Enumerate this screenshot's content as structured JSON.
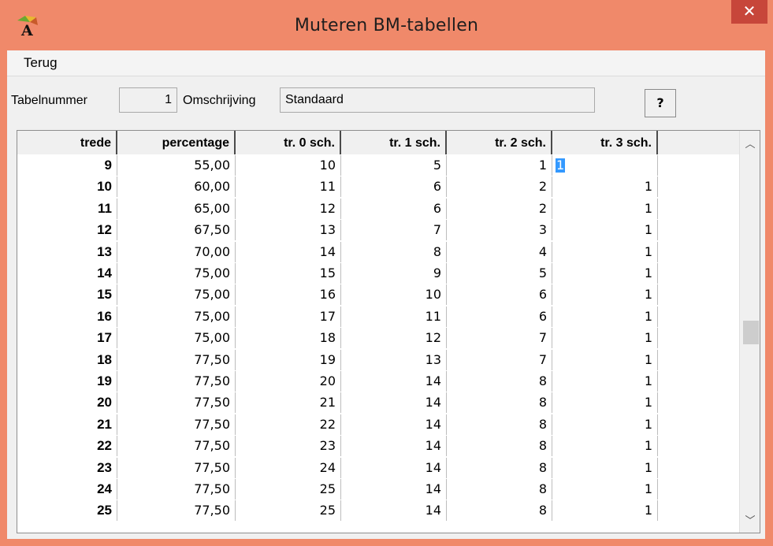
{
  "window": {
    "title": "Muteren BM-tabellen",
    "close_glyph": "✕",
    "icon": "app-A-icon"
  },
  "menu": {
    "items": [
      "Terug"
    ]
  },
  "fields": {
    "tabelnummer_label": "Tabelnummer",
    "tabelnummer_value": "1",
    "omschrijving_label": "Omschrijving",
    "omschrijving_value": "Standaard",
    "help_label": "?"
  },
  "table": {
    "columns": [
      "trede",
      "percentage",
      "tr. 0 sch.",
      "tr. 1 sch.",
      "tr. 2 sch.",
      "tr. 3 sch."
    ],
    "rows": [
      [
        "9",
        "55,00",
        "10",
        "5",
        "1",
        "1"
      ],
      [
        "10",
        "60,00",
        "11",
        "6",
        "2",
        "1"
      ],
      [
        "11",
        "65,00",
        "12",
        "6",
        "2",
        "1"
      ],
      [
        "12",
        "67,50",
        "13",
        "7",
        "3",
        "1"
      ],
      [
        "13",
        "70,00",
        "14",
        "8",
        "4",
        "1"
      ],
      [
        "14",
        "75,00",
        "15",
        "9",
        "5",
        "1"
      ],
      [
        "15",
        "75,00",
        "16",
        "10",
        "6",
        "1"
      ],
      [
        "16",
        "75,00",
        "17",
        "11",
        "6",
        "1"
      ],
      [
        "17",
        "75,00",
        "18",
        "12",
        "7",
        "1"
      ],
      [
        "18",
        "77,50",
        "19",
        "13",
        "7",
        "1"
      ],
      [
        "19",
        "77,50",
        "20",
        "14",
        "8",
        "1"
      ],
      [
        "20",
        "77,50",
        "21",
        "14",
        "8",
        "1"
      ],
      [
        "21",
        "77,50",
        "22",
        "14",
        "8",
        "1"
      ],
      [
        "22",
        "77,50",
        "23",
        "14",
        "8",
        "1"
      ],
      [
        "23",
        "77,50",
        "24",
        "14",
        "8",
        "1"
      ],
      [
        "24",
        "77,50",
        "25",
        "14",
        "8",
        "1"
      ],
      [
        "25",
        "77,50",
        "25",
        "14",
        "8",
        "1"
      ]
    ],
    "selected_cell": {
      "row": 0,
      "col": 5
    }
  },
  "scrollbar": {
    "up_glyph": "︿",
    "down_glyph": "﹀",
    "position_fraction": 0.52
  },
  "colors": {
    "titlebar": "#f0896a",
    "close": "#c7463a",
    "selection": "#3399ff"
  }
}
